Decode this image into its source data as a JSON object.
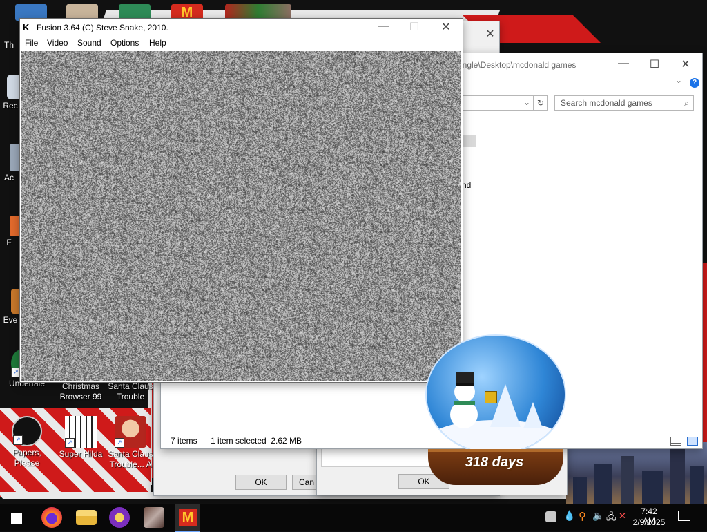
{
  "desktop": {
    "top_icons": [
      "desktop-icon-app-1",
      "desktop-icon-app-2",
      "desktop-icon-app-3",
      "desktop-icon-mcdonalds",
      "desktop-icon-santa-sleigh"
    ],
    "left_partial_labels": [
      "Th",
      "Rec",
      "Ac",
      "F",
      "Eve"
    ],
    "icons": [
      {
        "name": "Undertale",
        "line2": ""
      },
      {
        "name": "Christmas",
        "line2": "Browser 99"
      },
      {
        "name": "Santa Claus",
        "line2": "Trouble"
      },
      {
        "name": "Papers, Please",
        "line2": ""
      },
      {
        "name": "Super Hilda",
        "line2": ""
      },
      {
        "name": "Santa Claus",
        "line2": "Trouble... A"
      }
    ]
  },
  "explorer": {
    "path_partial": "ringle\\Desktop\\mcdonald games",
    "search_placeholder": "Search mcdonald games",
    "partial_text": "nd",
    "status_items": "7 items",
    "status_selected": "1 item selected  2.62 MB",
    "minimize": "—",
    "maximize": "☐",
    "close": "✕",
    "help_icon": "?"
  },
  "dialogs": {
    "ok_1": "OK",
    "cancel_1": "Can",
    "ok_2": "OK"
  },
  "fusion": {
    "title": "Fusion 3.64 (C) Steve Snake, 2010.",
    "menu": [
      "File",
      "Video",
      "Sound",
      "Options",
      "Help"
    ],
    "minimize": "—",
    "maximize": "☐",
    "close": "✕"
  },
  "snowglobe": {
    "days_text": "318 days"
  },
  "taskbar": {
    "apps": [
      "start-button",
      "firefox-icon",
      "file-explorer-icon",
      "game-app-icon",
      "photo-app-icon",
      "mcdonalds-app-icon"
    ],
    "time": "7:42 AM",
    "date": "2/9/2025"
  },
  "colors": {
    "wallpaper_red": "#cf1a1a",
    "explorer_accent": "#1b73e8",
    "mcdonalds_red": "#d52b1e",
    "mcdonalds_yellow": "#ffc72c"
  }
}
